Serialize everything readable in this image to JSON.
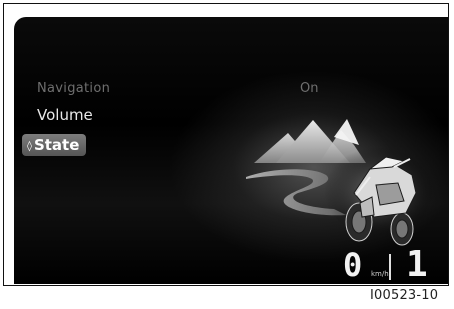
{
  "menu": {
    "items": [
      {
        "label": "Navigation",
        "state": "dimmed"
      },
      {
        "label": "Volume",
        "state": "normal"
      },
      {
        "label": "State",
        "state": "selected"
      }
    ],
    "selected_marker_icon": "diamond-arrow-icon"
  },
  "setting_value": "On",
  "status_bar": {
    "speed": "0",
    "speed_unit": "km/h",
    "gear": "1"
  },
  "illustration": {
    "subject": "motorcycle-on-road-with-mountains"
  },
  "figure_code": "I00523-10",
  "colors": {
    "screen_background": "#000000",
    "text_primary": "#e8e8e8",
    "text_dimmed": "#6f6f6f",
    "selection_background": "#666666"
  }
}
